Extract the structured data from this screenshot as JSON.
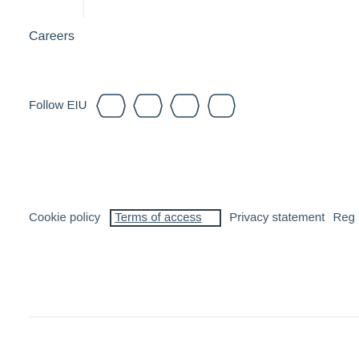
{
  "footer": {
    "careers_label": "Careers",
    "follow": {
      "label": "Follow EIU",
      "icons": [
        "social-icon-1",
        "social-icon-2",
        "social-icon-3",
        "social-icon-4"
      ]
    },
    "links": {
      "cookie": "Cookie policy",
      "terms": "Terms of access",
      "privacy": "Privacy statement",
      "reg": "Reg"
    }
  }
}
